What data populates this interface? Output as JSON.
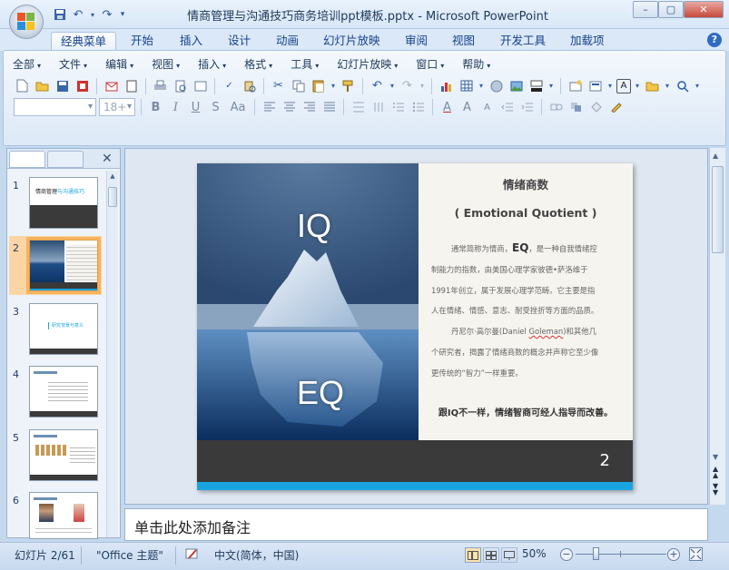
{
  "window": {
    "title": "情商管理与沟通技巧商务培训ppt模板.pptx - Microsoft PowerPoint",
    "minimize": "–",
    "restore": "▢",
    "close": "✕"
  },
  "ribbon_tabs": [
    "经典菜单",
    "开始",
    "插入",
    "设计",
    "动画",
    "幻灯片放映",
    "审阅",
    "视图",
    "开发工具",
    "加载项"
  ],
  "menu_items": [
    "全部",
    "文件",
    "编辑",
    "视图",
    "插入",
    "格式",
    "工具",
    "幻灯片放映",
    "窗口",
    "帮助"
  ],
  "format_bar": {
    "font_size": "18+",
    "bold": "B",
    "italic": "I",
    "underline": "U",
    "strike": "S",
    "change_case": "Aa"
  },
  "slide_numbers": [
    "1",
    "2",
    "3",
    "4",
    "5",
    "6"
  ],
  "thumb_titles": {
    "1a": "情商管理",
    "1b": "与沟通技巧",
    "3": "研究背景与意义"
  },
  "slide": {
    "iq": "IQ",
    "eq": "EQ",
    "heading": "情绪商数",
    "subheading": "( Emotional Quotient )",
    "para1_a": "通常简称为情商，",
    "para1_eq": "EQ",
    "para1_b": "，是一种自我情绪控",
    "para1_lines": [
      "制能力的指数，由美国心理学家彼德•萨洛维于",
      "1991年创立，属于发展心理学范畴。它主要是指",
      "人在情绪、情感、意志、耐受挫折等方面的品质。"
    ],
    "para2_a": "丹尼尔·高尔曼(Daniel ",
    "para2_name": "Goleman",
    "para2_b": ")和其他几",
    "para2_lines": [
      "个研究者，揭露了情绪商数的概念并声称它至少像",
      "更传统的“智力”一样重要。"
    ],
    "bold_line": "跟IQ不一样，情绪智商可经人指导而改善。",
    "page_number": "2"
  },
  "notes_placeholder": "单击此处添加备注",
  "status": {
    "slide_indicator": "幻灯片 2/61",
    "theme": "\"Office 主题\"",
    "language": "中文(简体，中国)",
    "zoom": "50%"
  },
  "colors": {
    "accent_stripe": "#1aa4e0",
    "footer": "#3a3a3a",
    "selection": "#f5b45e"
  }
}
